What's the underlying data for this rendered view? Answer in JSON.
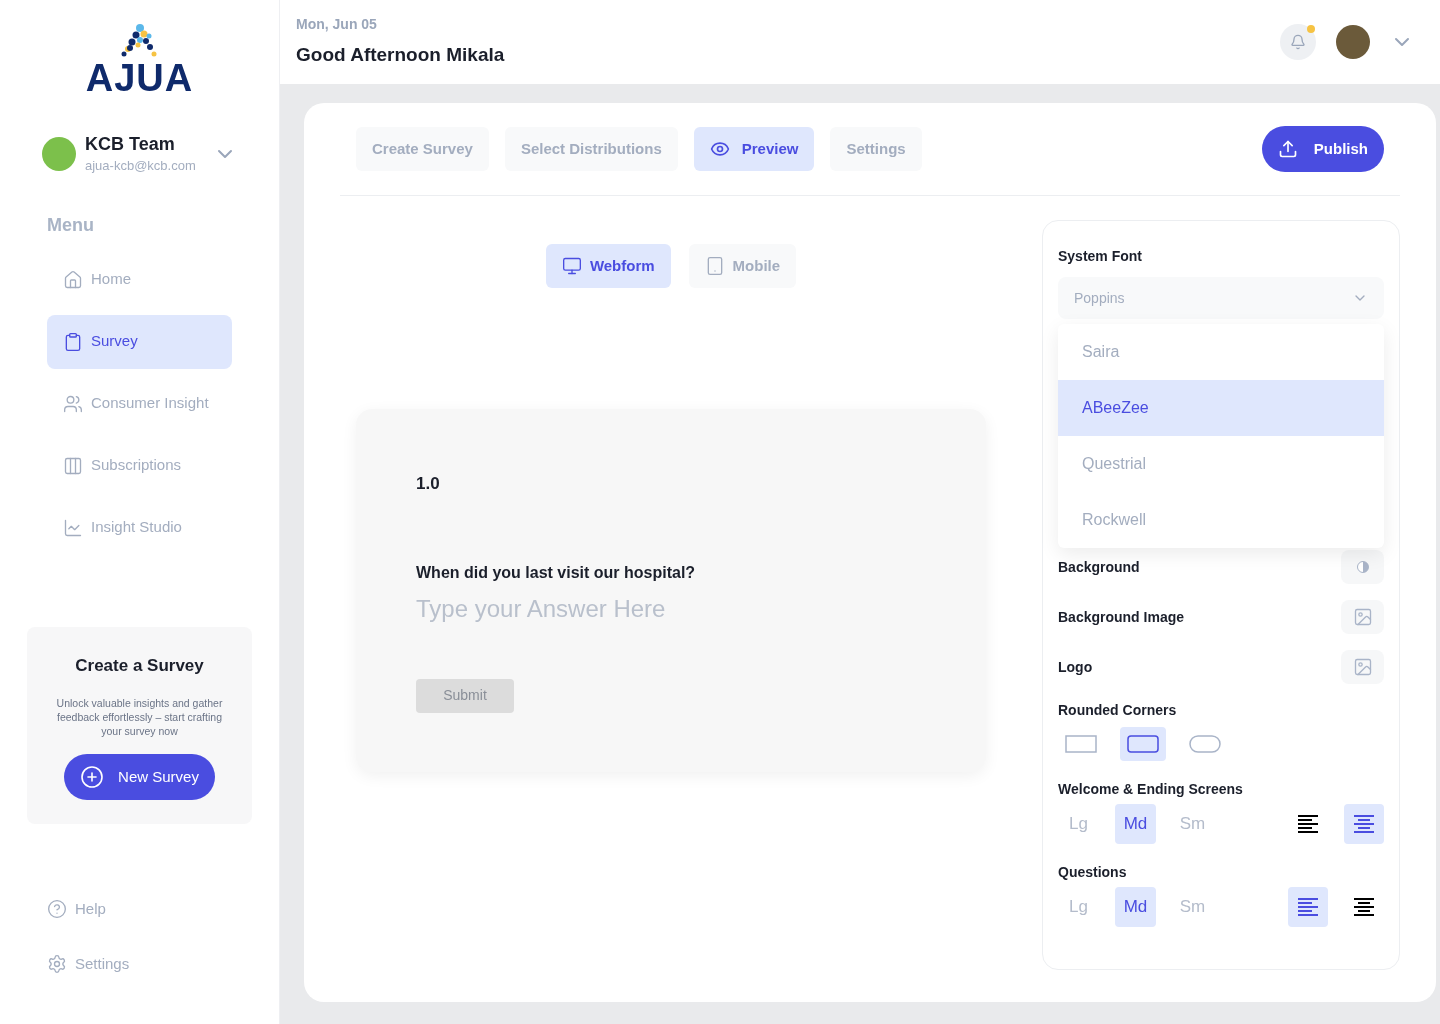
{
  "sidebar": {
    "brand": "AJUA",
    "team": {
      "name": "KCB Team",
      "email": "ajua-kcb@kcb.com"
    },
    "menu_title": "Menu",
    "menu": [
      {
        "label": "Home",
        "selected": false
      },
      {
        "label": "Survey",
        "selected": true
      },
      {
        "label": "Consumer Insight",
        "selected": false
      },
      {
        "label": "Subscriptions",
        "selected": false
      },
      {
        "label": "Insight Studio",
        "selected": false
      }
    ],
    "promo": {
      "title": "Create a Survey",
      "text": "Unlock valuable insights and gather feedback effortlessly – start crafting your survey now",
      "button": "New Survey"
    },
    "footer": [
      {
        "label": "Help"
      },
      {
        "label": "Settings"
      }
    ]
  },
  "header": {
    "date": "Mon, Jun 05",
    "greeting": "Good Afternoon Mikala",
    "notification": true
  },
  "tabs": [
    {
      "label": "Create Survey",
      "selected": false
    },
    {
      "label": "Select Distributions",
      "selected": false
    },
    {
      "label": "Preview",
      "selected": true
    },
    {
      "label": "Settings",
      "selected": false
    }
  ],
  "publish": "Publish",
  "view_toggle": [
    {
      "label": "Webform",
      "kind": "desktop",
      "selected": true
    },
    {
      "label": "Mobile",
      "kind": "mobile",
      "selected": false
    }
  ],
  "preview": {
    "number": "1.0",
    "question": "When did you last visit our hospital?",
    "placeholder": "Type your Answer Here",
    "submit": "Submit",
    "submit_disabled": true
  },
  "settings": {
    "system_font": {
      "label": "System Font",
      "value": "Poppins",
      "expanded": true,
      "options": [
        {
          "label": "Saira",
          "selected": false
        },
        {
          "label": "ABeeZee",
          "selected": true
        },
        {
          "label": "Questrial",
          "selected": false
        },
        {
          "label": "Rockwell",
          "selected": false
        }
      ]
    },
    "rows": [
      {
        "label": "Background",
        "kind": "color"
      },
      {
        "label": "Background Image",
        "kind": "image"
      },
      {
        "label": "Logo",
        "kind": "image"
      }
    ],
    "rounded_corners": {
      "label": "Rounded Corners",
      "options": [
        {
          "kind": "square",
          "selected": false
        },
        {
          "kind": "rounded",
          "selected": true
        },
        {
          "kind": "pill",
          "selected": false
        }
      ]
    },
    "sections": [
      {
        "label": "Welcome & Ending Screens",
        "sizes": [
          {
            "label": "Lg",
            "selected": false
          },
          {
            "label": "Md",
            "selected": true
          },
          {
            "label": "Sm",
            "selected": false
          }
        ],
        "aligns": [
          {
            "kind": "left",
            "selected": false
          },
          {
            "kind": "center",
            "selected": true
          }
        ]
      },
      {
        "label": "Questions",
        "sizes": [
          {
            "label": "Lg",
            "selected": false
          },
          {
            "label": "Md",
            "selected": true
          },
          {
            "label": "Sm",
            "selected": false
          }
        ],
        "aligns": [
          {
            "kind": "left",
            "selected": true
          },
          {
            "kind": "center",
            "selected": false
          }
        ]
      }
    ]
  }
}
